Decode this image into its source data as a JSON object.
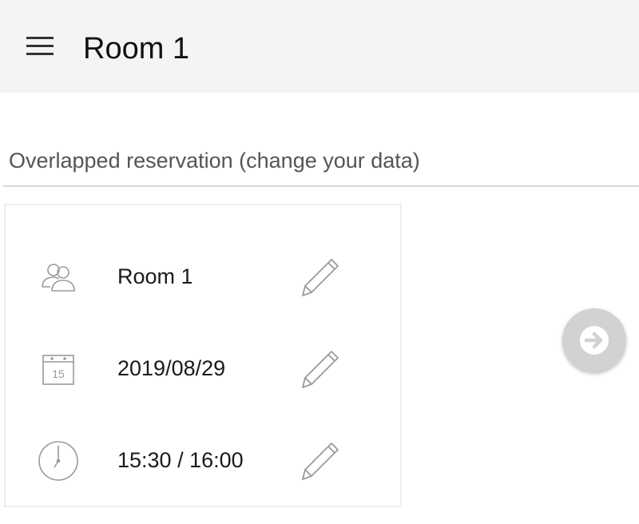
{
  "header": {
    "title": "Room 1",
    "menu_icon": "hamburger-menu-icon",
    "background": "#f4f4f4"
  },
  "message": "Overlapped reservation (change your data)",
  "reservation": {
    "room": {
      "icon": "people-icon",
      "value": "Room 1"
    },
    "date": {
      "icon": "calendar-icon",
      "value": "2019/08/29",
      "calendar_day": "15"
    },
    "time": {
      "icon": "clock-icon",
      "value": "15:30 / 16:00"
    }
  },
  "edit_icon": "pencil-icon",
  "next_button": {
    "icon": "arrow-right-icon",
    "color": "#d2d2d2"
  }
}
